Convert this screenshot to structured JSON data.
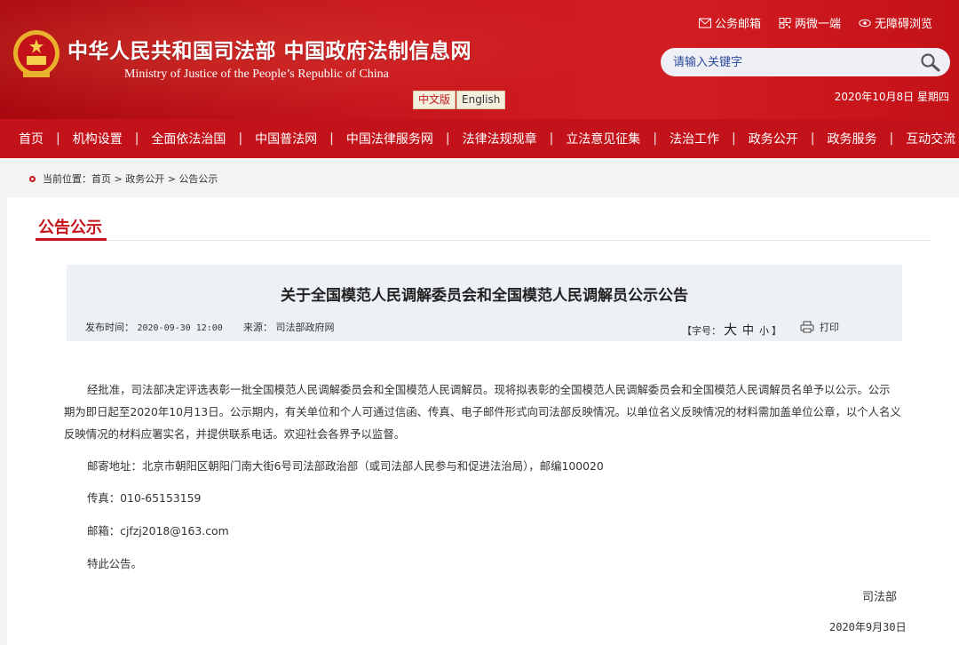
{
  "header": {
    "title": "中华人民共和国司法部 中国政府法制信息网",
    "subtitle": "Ministry of Justice of the People’s Republic of China",
    "lang_cn": "中文版",
    "lang_en": "English",
    "toplinks": [
      "公务邮箱",
      "两微一端",
      "无障碍浏览"
    ],
    "search_placeholder": "请输入关键字",
    "date": "2020年10月8日 星期四"
  },
  "nav": {
    "items": [
      "首页",
      "机构设置",
      "全面依法治国",
      "中国普法网",
      "中国法律服务网",
      "法律法规规章",
      "立法意见征集",
      "法治工作",
      "政务公开",
      "政务服务",
      "互动交流"
    ]
  },
  "breadcrumb": {
    "prefix": "当前位置：",
    "items": [
      "首页",
      "政务公开",
      "公告公示"
    ],
    "separator": ">"
  },
  "section": {
    "title": "公告公示"
  },
  "article": {
    "title": "关于全国模范人民调解委员会和全国模范人民调解员公示公告",
    "time_label": "发布时间：",
    "time": "2020-09-30 12:00",
    "source_label": "来源：",
    "source": "司法部政府网",
    "font_label": "【字号：",
    "font_large": "大",
    "font_medium": "中",
    "font_small": "小",
    "font_close": "】",
    "print": "打印",
    "p1_line1": "经批准，司法部决定评选表彰一批全国模范人民调解委员会和全国模范人民调解员。现将拟表彰的全国模范人民调解委员会和全国模范人民调解员名单予以公示。公示",
    "p1_line2": "期为即日起至2020年10月13日。公示期内，有关单位和个人可通过信函、传真、电子邮件形式向司法部反映情况。以单位名义反映情况的材料需加盖单位公章，以个人名义",
    "p1_line3": "反映情况的材料应署实名，并提供联系电话。欢迎社会各界予以监督。",
    "address": "邮寄地址：北京市朝阳区朝阳门南大街6号司法部政治部（或司法部人民参与和促进法治局），邮编100020",
    "fax": "传真：010-65153159",
    "email": "邮箱：cjfzj2018@163.com",
    "closing": "特此公告。",
    "signer": "司法部",
    "sign_date": "2020年9月30日"
  },
  "colors": {
    "brand_red": "#c3121a",
    "header_panel": "#edf0f5"
  }
}
